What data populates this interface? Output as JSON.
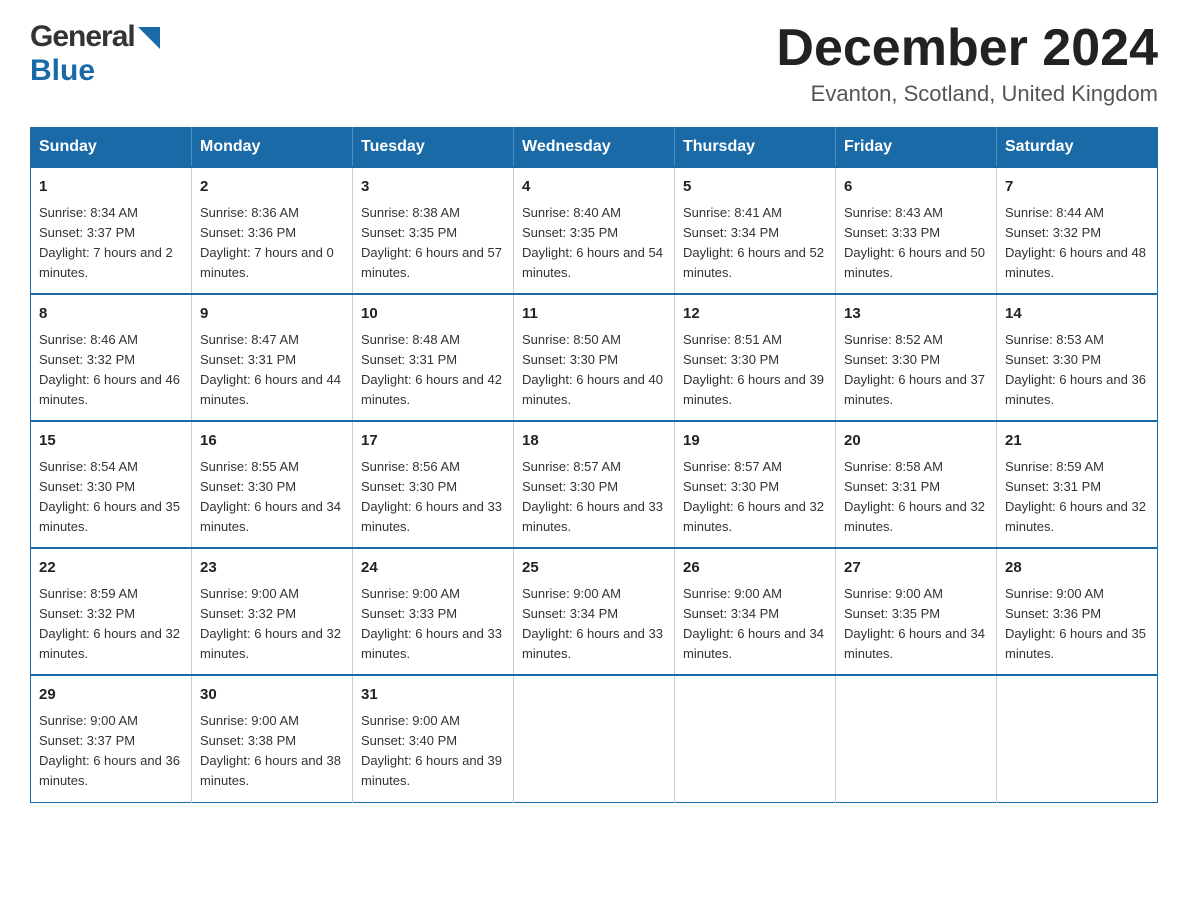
{
  "header": {
    "title": "December 2024",
    "location": "Evanton, Scotland, United Kingdom",
    "logo_general": "General",
    "logo_blue": "Blue"
  },
  "days_of_week": [
    "Sunday",
    "Monday",
    "Tuesday",
    "Wednesday",
    "Thursday",
    "Friday",
    "Saturday"
  ],
  "weeks": [
    [
      {
        "day": "1",
        "sunrise": "8:34 AM",
        "sunset": "3:37 PM",
        "daylight": "7 hours and 2 minutes."
      },
      {
        "day": "2",
        "sunrise": "8:36 AM",
        "sunset": "3:36 PM",
        "daylight": "7 hours and 0 minutes."
      },
      {
        "day": "3",
        "sunrise": "8:38 AM",
        "sunset": "3:35 PM",
        "daylight": "6 hours and 57 minutes."
      },
      {
        "day": "4",
        "sunrise": "8:40 AM",
        "sunset": "3:35 PM",
        "daylight": "6 hours and 54 minutes."
      },
      {
        "day": "5",
        "sunrise": "8:41 AM",
        "sunset": "3:34 PM",
        "daylight": "6 hours and 52 minutes."
      },
      {
        "day": "6",
        "sunrise": "8:43 AM",
        "sunset": "3:33 PM",
        "daylight": "6 hours and 50 minutes."
      },
      {
        "day": "7",
        "sunrise": "8:44 AM",
        "sunset": "3:32 PM",
        "daylight": "6 hours and 48 minutes."
      }
    ],
    [
      {
        "day": "8",
        "sunrise": "8:46 AM",
        "sunset": "3:32 PM",
        "daylight": "6 hours and 46 minutes."
      },
      {
        "day": "9",
        "sunrise": "8:47 AM",
        "sunset": "3:31 PM",
        "daylight": "6 hours and 44 minutes."
      },
      {
        "day": "10",
        "sunrise": "8:48 AM",
        "sunset": "3:31 PM",
        "daylight": "6 hours and 42 minutes."
      },
      {
        "day": "11",
        "sunrise": "8:50 AM",
        "sunset": "3:30 PM",
        "daylight": "6 hours and 40 minutes."
      },
      {
        "day": "12",
        "sunrise": "8:51 AM",
        "sunset": "3:30 PM",
        "daylight": "6 hours and 39 minutes."
      },
      {
        "day": "13",
        "sunrise": "8:52 AM",
        "sunset": "3:30 PM",
        "daylight": "6 hours and 37 minutes."
      },
      {
        "day": "14",
        "sunrise": "8:53 AM",
        "sunset": "3:30 PM",
        "daylight": "6 hours and 36 minutes."
      }
    ],
    [
      {
        "day": "15",
        "sunrise": "8:54 AM",
        "sunset": "3:30 PM",
        "daylight": "6 hours and 35 minutes."
      },
      {
        "day": "16",
        "sunrise": "8:55 AM",
        "sunset": "3:30 PM",
        "daylight": "6 hours and 34 minutes."
      },
      {
        "day": "17",
        "sunrise": "8:56 AM",
        "sunset": "3:30 PM",
        "daylight": "6 hours and 33 minutes."
      },
      {
        "day": "18",
        "sunrise": "8:57 AM",
        "sunset": "3:30 PM",
        "daylight": "6 hours and 33 minutes."
      },
      {
        "day": "19",
        "sunrise": "8:57 AM",
        "sunset": "3:30 PM",
        "daylight": "6 hours and 32 minutes."
      },
      {
        "day": "20",
        "sunrise": "8:58 AM",
        "sunset": "3:31 PM",
        "daylight": "6 hours and 32 minutes."
      },
      {
        "day": "21",
        "sunrise": "8:59 AM",
        "sunset": "3:31 PM",
        "daylight": "6 hours and 32 minutes."
      }
    ],
    [
      {
        "day": "22",
        "sunrise": "8:59 AM",
        "sunset": "3:32 PM",
        "daylight": "6 hours and 32 minutes."
      },
      {
        "day": "23",
        "sunrise": "9:00 AM",
        "sunset": "3:32 PM",
        "daylight": "6 hours and 32 minutes."
      },
      {
        "day": "24",
        "sunrise": "9:00 AM",
        "sunset": "3:33 PM",
        "daylight": "6 hours and 33 minutes."
      },
      {
        "day": "25",
        "sunrise": "9:00 AM",
        "sunset": "3:34 PM",
        "daylight": "6 hours and 33 minutes."
      },
      {
        "day": "26",
        "sunrise": "9:00 AM",
        "sunset": "3:34 PM",
        "daylight": "6 hours and 34 minutes."
      },
      {
        "day": "27",
        "sunrise": "9:00 AM",
        "sunset": "3:35 PM",
        "daylight": "6 hours and 34 minutes."
      },
      {
        "day": "28",
        "sunrise": "9:00 AM",
        "sunset": "3:36 PM",
        "daylight": "6 hours and 35 minutes."
      }
    ],
    [
      {
        "day": "29",
        "sunrise": "9:00 AM",
        "sunset": "3:37 PM",
        "daylight": "6 hours and 36 minutes."
      },
      {
        "day": "30",
        "sunrise": "9:00 AM",
        "sunset": "3:38 PM",
        "daylight": "6 hours and 38 minutes."
      },
      {
        "day": "31",
        "sunrise": "9:00 AM",
        "sunset": "3:40 PM",
        "daylight": "6 hours and 39 minutes."
      },
      null,
      null,
      null,
      null
    ]
  ],
  "labels": {
    "sunrise": "Sunrise:",
    "sunset": "Sunset:",
    "daylight": "Daylight:"
  }
}
